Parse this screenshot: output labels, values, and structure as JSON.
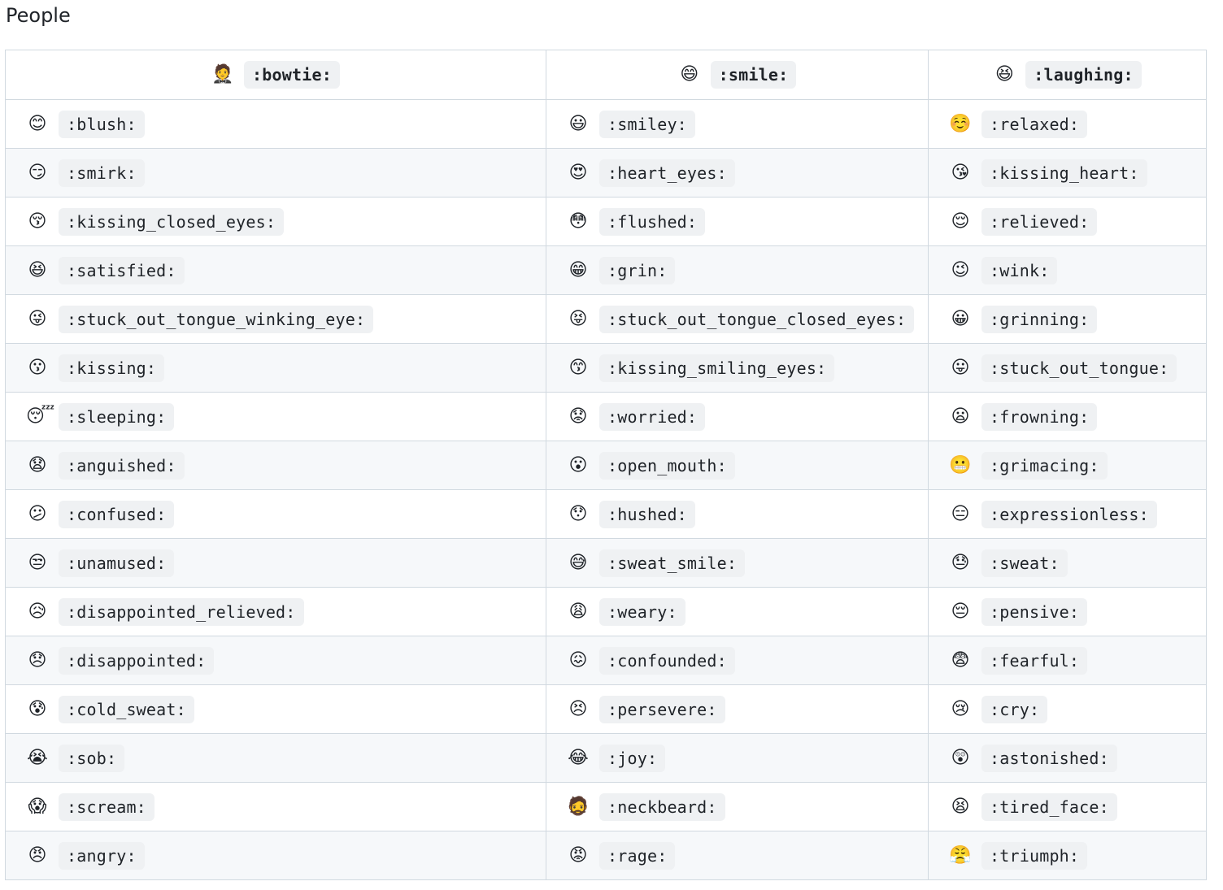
{
  "page": {
    "title": "People"
  },
  "header": [
    {
      "emoji": "🤵",
      "code": ":bowtie:"
    },
    {
      "emoji": "😄",
      "code": ":smile:"
    },
    {
      "emoji": "😆",
      "code": ":laughing:"
    }
  ],
  "rows": [
    [
      {
        "emoji": "😊",
        "code": ":blush:"
      },
      {
        "emoji": "😃",
        "code": ":smiley:"
      },
      {
        "emoji": "☺️",
        "code": ":relaxed:"
      }
    ],
    [
      {
        "emoji": "😏",
        "code": ":smirk:"
      },
      {
        "emoji": "😍",
        "code": ":heart_eyes:"
      },
      {
        "emoji": "😘",
        "code": ":kissing_heart:"
      }
    ],
    [
      {
        "emoji": "😚",
        "code": ":kissing_closed_eyes:"
      },
      {
        "emoji": "😳",
        "code": ":flushed:"
      },
      {
        "emoji": "😌",
        "code": ":relieved:"
      }
    ],
    [
      {
        "emoji": "😆",
        "code": ":satisfied:"
      },
      {
        "emoji": "😁",
        "code": ":grin:"
      },
      {
        "emoji": "😉",
        "code": ":wink:"
      }
    ],
    [
      {
        "emoji": "😜",
        "code": ":stuck_out_tongue_winking_eye:"
      },
      {
        "emoji": "😝",
        "code": ":stuck_out_tongue_closed_eyes:"
      },
      {
        "emoji": "😀",
        "code": ":grinning:"
      }
    ],
    [
      {
        "emoji": "😗",
        "code": ":kissing:"
      },
      {
        "emoji": "😙",
        "code": ":kissing_smiling_eyes:"
      },
      {
        "emoji": "😛",
        "code": ":stuck_out_tongue:"
      }
    ],
    [
      {
        "emoji": "😴",
        "code": ":sleeping:"
      },
      {
        "emoji": "😟",
        "code": ":worried:"
      },
      {
        "emoji": "😦",
        "code": ":frowning:"
      }
    ],
    [
      {
        "emoji": "😧",
        "code": ":anguished:"
      },
      {
        "emoji": "😮",
        "code": ":open_mouth:"
      },
      {
        "emoji": "😬",
        "code": ":grimacing:"
      }
    ],
    [
      {
        "emoji": "😕",
        "code": ":confused:"
      },
      {
        "emoji": "😯",
        "code": ":hushed:"
      },
      {
        "emoji": "😑",
        "code": ":expressionless:"
      }
    ],
    [
      {
        "emoji": "😒",
        "code": ":unamused:"
      },
      {
        "emoji": "😅",
        "code": ":sweat_smile:"
      },
      {
        "emoji": "😓",
        "code": ":sweat:"
      }
    ],
    [
      {
        "emoji": "😥",
        "code": ":disappointed_relieved:"
      },
      {
        "emoji": "😩",
        "code": ":weary:"
      },
      {
        "emoji": "😔",
        "code": ":pensive:"
      }
    ],
    [
      {
        "emoji": "😞",
        "code": ":disappointed:"
      },
      {
        "emoji": "😖",
        "code": ":confounded:"
      },
      {
        "emoji": "😨",
        "code": ":fearful:"
      }
    ],
    [
      {
        "emoji": "😰",
        "code": ":cold_sweat:"
      },
      {
        "emoji": "😣",
        "code": ":persevere:"
      },
      {
        "emoji": "😢",
        "code": ":cry:"
      }
    ],
    [
      {
        "emoji": "😭",
        "code": ":sob:"
      },
      {
        "emoji": "😂",
        "code": ":joy:"
      },
      {
        "emoji": "😲",
        "code": ":astonished:"
      }
    ],
    [
      {
        "emoji": "😱",
        "code": ":scream:"
      },
      {
        "emoji": "🧔",
        "code": ":neckbeard:"
      },
      {
        "emoji": "😫",
        "code": ":tired_face:"
      }
    ],
    [
      {
        "emoji": "😠",
        "code": ":angry:"
      },
      {
        "emoji": "😡",
        "code": ":rage:"
      },
      {
        "emoji": "😤",
        "code": ":triumph:"
      }
    ]
  ]
}
